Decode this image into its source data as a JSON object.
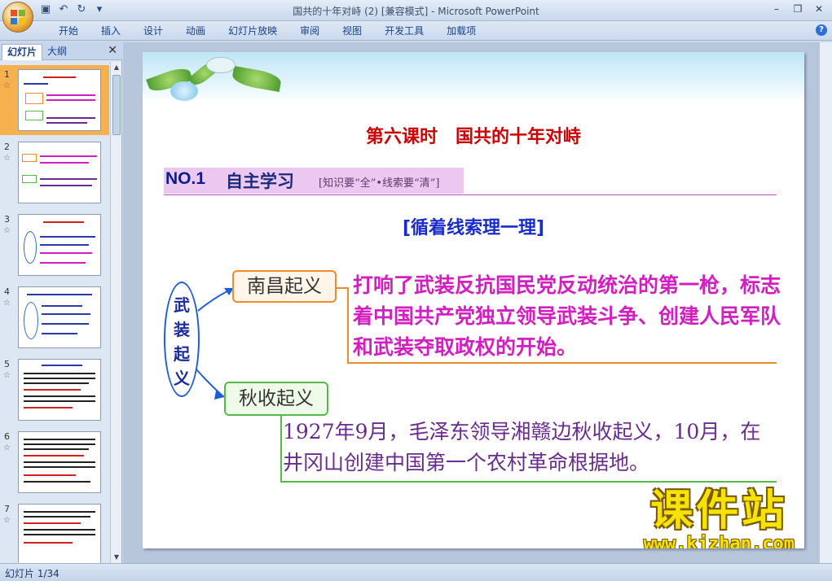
{
  "window": {
    "title": "国共的十年对峙 (2) [兼容模式] - Microsoft PowerPoint"
  },
  "ribbon": {
    "tabs": [
      "开始",
      "插入",
      "设计",
      "动画",
      "幻灯片放映",
      "审阅",
      "视图",
      "开发工具",
      "加载项"
    ]
  },
  "left_pane": {
    "tab_slides": "幻灯片",
    "tab_outline": "大纲",
    "close_label": "✕",
    "thumbnails": [
      "1",
      "2",
      "3",
      "4",
      "5",
      "6",
      "7"
    ],
    "selected_index": 1
  },
  "slide": {
    "title": "第六课时　国共的十年对峙",
    "no1_label": "NO.1",
    "no1_title": "自主学习",
    "no1_sub": "[知识要“全”•线索要“清”]",
    "section_head": "[循着线索理一理]",
    "root_label": "武装起义",
    "node1_label": "南昌起义",
    "node1_desc": "打响了武装反抗国民党反动统治的第一枪，标志着中国共产党独立领导武装斗争、创建人民军队和武装夺取政权的开始。",
    "node2_label": "秋收起义",
    "node2_desc": "1927年9月，毛泽东领导湘赣边秋收起义，10月，在井冈山创建中国第一个农村革命根据地。",
    "watermark_cn": "课件站",
    "watermark_en": "www.kjzhan.com"
  },
  "statusbar": {
    "slide_counter": "幻灯片 1/34"
  },
  "colors": {
    "title_red": "#cc0000",
    "desc_magenta": "#d41fc0",
    "desc_purple": "#6a2c8c",
    "node_orange": "#f08a2a",
    "node_green": "#59b84a",
    "accent_blue": "#1a2bcc"
  }
}
